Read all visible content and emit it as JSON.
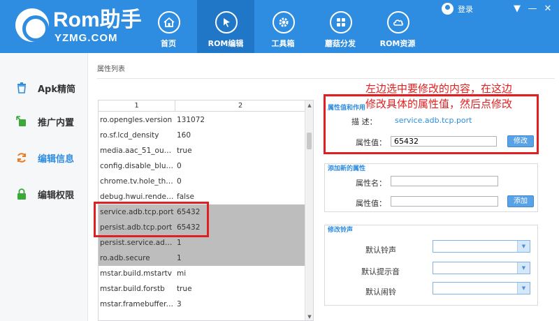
{
  "brand": {
    "name": "Rom助手",
    "domain": "YZMG.COM"
  },
  "colors": {
    "primary": "#2e8de0",
    "nav_active": "#2077c8",
    "selection": "#bdbdbd",
    "highlight": "#e02020"
  },
  "header": {
    "nav": [
      {
        "label": "首页",
        "icon": "home-icon"
      },
      {
        "label": "ROM编辑",
        "icon": "cursor-icon",
        "active": true
      },
      {
        "label": "工具箱",
        "icon": "gear-icon"
      },
      {
        "label": "蘑菇分发",
        "icon": "grid-icon"
      },
      {
        "label": "ROM资源",
        "icon": "cloud-icon"
      }
    ],
    "login_label": "登录",
    "window_controls": [
      "▼",
      "—",
      "✕"
    ]
  },
  "sidebar": {
    "items": [
      {
        "label": "Apk精简",
        "icon": "trash-icon"
      },
      {
        "label": "推广内置",
        "icon": "push-icon"
      },
      {
        "label": "编辑信息",
        "icon": "refresh-icon",
        "active": true
      },
      {
        "label": "编辑权限",
        "icon": "lock-icon"
      }
    ]
  },
  "main": {
    "section_title": "属性列表",
    "table": {
      "columns": [
        "1",
        "2"
      ],
      "rows": [
        {
          "key": "ro.opengles.version",
          "value": "131072"
        },
        {
          "key": "ro.sf.lcd_density",
          "value": "160"
        },
        {
          "key": "media.aac_51_outp...",
          "value": "true"
        },
        {
          "key": "config.disable_blue...",
          "value": "0"
        },
        {
          "key": "chrome.tv.hole_thre...",
          "value": "0"
        },
        {
          "key": "debug.hwui.render...",
          "value": "false"
        },
        {
          "key": "service.adb.tcp.port",
          "value": "65432",
          "selected": true
        },
        {
          "key": "persist.adb.tcp.port",
          "value": "65432",
          "selected": true
        },
        {
          "key": "persist.service.adb.e...",
          "value": "1",
          "selected": true
        },
        {
          "key": "ro.adb.secure",
          "value": "1",
          "selected": true
        },
        {
          "key": "mstar.build.mstartv",
          "value": "mi"
        },
        {
          "key": "mstar.build.forstb",
          "value": "true"
        },
        {
          "key": "mstar.framebuffer.f...",
          "value": "3"
        }
      ]
    },
    "prop_panel": {
      "title": "属性值和作用",
      "desc_label": "描 述：",
      "desc_value": "service.adb.tcp.port",
      "value_label": "属性值：",
      "value": "65432",
      "modify_button": "修改"
    },
    "add_panel": {
      "title": "添加新的属性",
      "name_label": "属性名：",
      "name_value": "",
      "value_label": "属性值：",
      "value_value": "",
      "add_button": "添加"
    },
    "ring_panel": {
      "title": "修改铃声",
      "ringtone_label": "默认铃声",
      "notification_label": "默认提示音",
      "alarm_label": "默认闹铃"
    },
    "annotation": [
      "左边选中要修改的内容，在这边",
      "修改具体的属性值，然后点修改"
    ]
  }
}
